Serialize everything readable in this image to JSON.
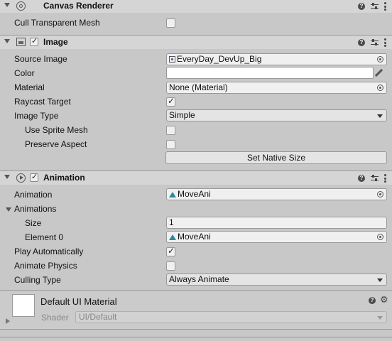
{
  "canvas_renderer": {
    "title": "Canvas Renderer",
    "cull_label": "Cull Transparent Mesh"
  },
  "image": {
    "title": "Image",
    "source_image_label": "Source Image",
    "source_image_value": "EveryDay_DevUp_Big",
    "color_label": "Color",
    "material_label": "Material",
    "material_value": "None (Material)",
    "raycast_label": "Raycast Target",
    "image_type_label": "Image Type",
    "image_type_value": "Simple",
    "use_sprite_mesh_label": "Use Sprite Mesh",
    "preserve_aspect_label": "Preserve Aspect",
    "set_native_size_label": "Set Native Size"
  },
  "animation": {
    "title": "Animation",
    "animation_label": "Animation",
    "animation_value": "MoveAni",
    "animations_label": "Animations",
    "size_label": "Size",
    "size_value": "1",
    "element0_label": "Element 0",
    "element0_value": "MoveAni",
    "play_auto_label": "Play Automatically",
    "animate_physics_label": "Animate Physics",
    "culling_type_label": "Culling Type",
    "culling_type_value": "Always Animate"
  },
  "material": {
    "title": "Default UI Material",
    "shader_label": "Shader",
    "shader_value": "UI/Default"
  },
  "colors": {
    "panel_bg": "#c8c8c8",
    "header_bg": "#d5d5d5",
    "anim_icon": "#2c8a9a"
  }
}
